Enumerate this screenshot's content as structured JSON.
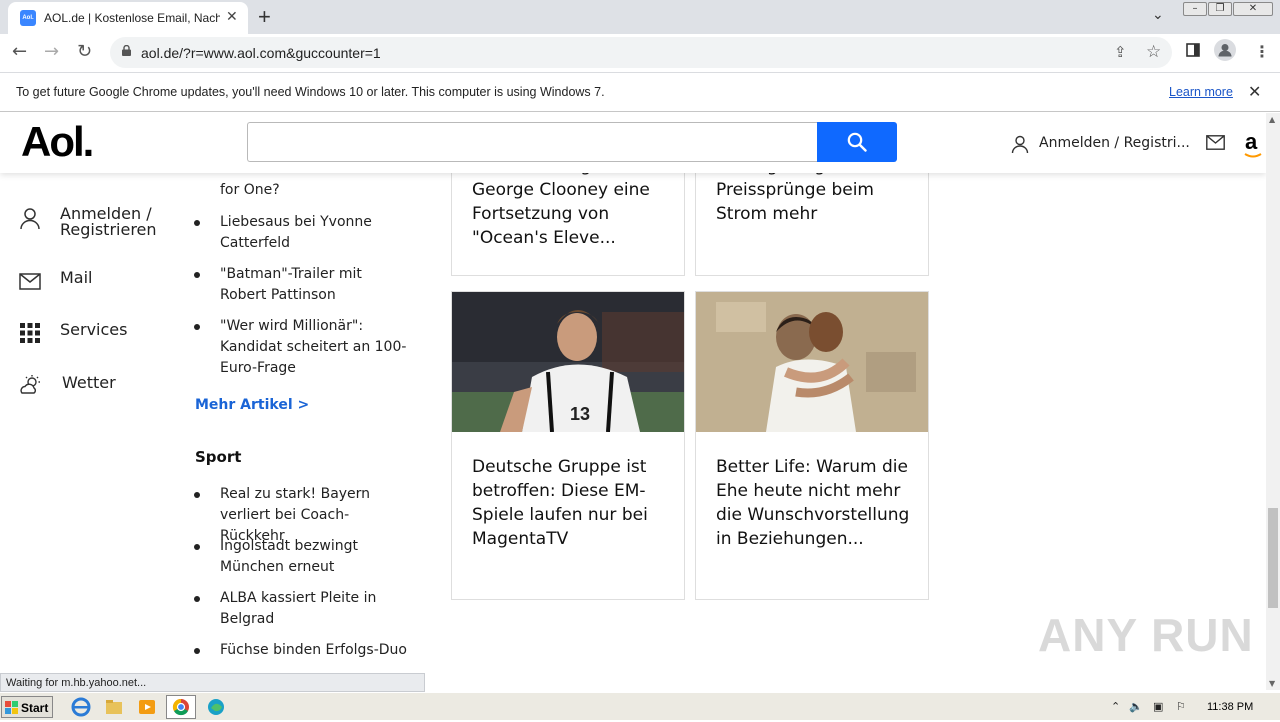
{
  "browser": {
    "tab_title": "AOL.de | Kostenlose Email, Nachrichten",
    "tab_favicon_text": "Aol.",
    "new_tab_symbol": "+",
    "url": "aol.de/?r=www.aol.com&guccounter=1"
  },
  "infobar": {
    "message": "To get future Google Chrome updates, you'll need Windows 10 or later. This computer is using Windows 7.",
    "link": "Learn more"
  },
  "aol": {
    "logo": "Aol.",
    "search_placeholder": "",
    "signin": "Anmelden / Registri...",
    "amazon": "a"
  },
  "left_nav": {
    "signin": "Anmelden / Registrieren",
    "mail": "Mail",
    "services": "Services",
    "weather": "Wetter"
  },
  "news_list": {
    "partial_top": "Wann kommt heute Dinner for One?",
    "items": [
      "Liebesaus bei Yvonne Catterfeld",
      "\"Batman\"-Trailer mit Robert Pattinson",
      "\"Wer wird Millionär\": Kandidat scheitert an 100-Euro-Frage"
    ],
    "more": "Mehr Artikel >"
  },
  "sport": {
    "heading": "Sport",
    "items": [
      "Real zu stark! Bayern verliert bei Coach-Rückkehr",
      "Ingolstadt bezwingt München erneut",
      "ALBA kassiert Pleite in Belgrad",
      "Füchse binden Erfolgs-Duo"
    ]
  },
  "cards": {
    "top_left": "Überraschung! Plant George Clooney eine Fortsetzung von \"Ocean's Eleve...",
    "top_right": "EU-Regelung: Keine Preissprünge beim Strom mehr",
    "bottom_left": "Deutsche Gruppe ist betroffen: Diese EM-Spiele laufen nur bei MagentaTV",
    "bottom_right": "Better Life: Warum die Ehe heute nicht mehr die Wunschvorstellung in Beziehungen..."
  },
  "status": "Waiting for m.hb.yahoo.net...",
  "watermark": "ANY RUN",
  "taskbar": {
    "start": "Start",
    "clock": "11:38 PM"
  },
  "colors": {
    "aol_blue": "#0f69ff",
    "link_blue": "#1a64d6"
  }
}
